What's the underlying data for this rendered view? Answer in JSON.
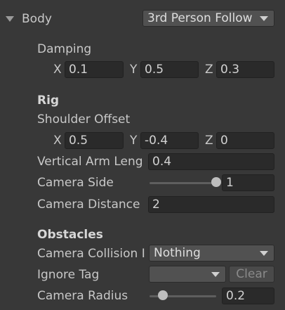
{
  "body": {
    "label": "Body",
    "mode_dropdown": "3rd Person Follow"
  },
  "damping": {
    "label": "Damping",
    "x_label": "X",
    "x_value": "0.1",
    "y_label": "Y",
    "y_value": "0.5",
    "z_label": "Z",
    "z_value": "0.3"
  },
  "rig": {
    "heading": "Rig",
    "shoulder_offset": {
      "label": "Shoulder Offset",
      "x_label": "X",
      "x_value": "0.5",
      "y_label": "Y",
      "y_value": "-0.4",
      "z_label": "Z",
      "z_value": "0"
    },
    "vertical_arm_length": {
      "label": "Vertical Arm Leng",
      "value": "0.4"
    },
    "camera_side": {
      "label": "Camera Side",
      "value": "1",
      "slider_fraction": 1.0
    },
    "camera_distance": {
      "label": "Camera Distance",
      "value": "2"
    }
  },
  "obstacles": {
    "heading": "Obstacles",
    "camera_collision": {
      "label": "Camera Collision I",
      "value": "Nothing"
    },
    "ignore_tag": {
      "label": "Ignore Tag",
      "value": "",
      "clear_button": "Clear"
    },
    "camera_radius": {
      "label": "Camera Radius",
      "value": "0.2",
      "slider_fraction": 0.2
    }
  }
}
